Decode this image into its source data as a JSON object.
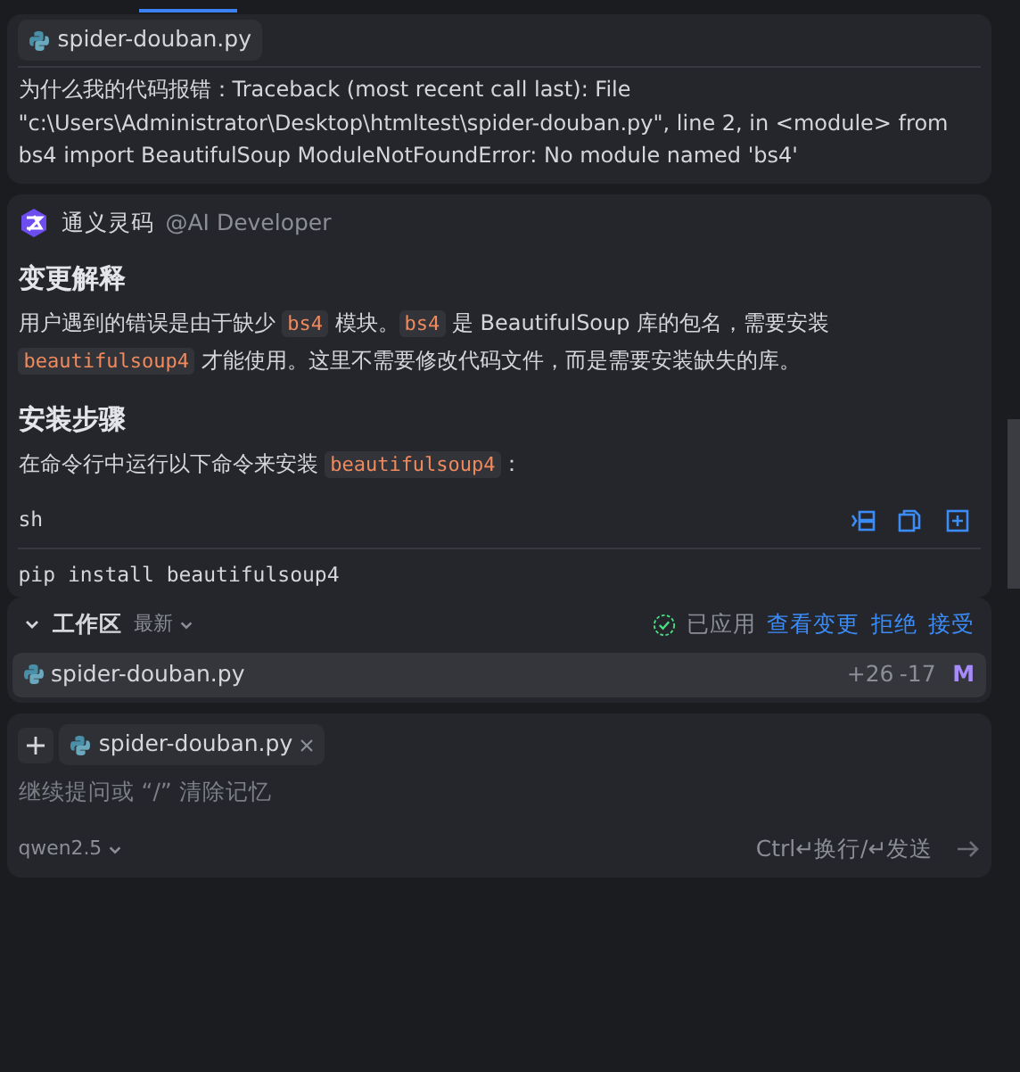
{
  "user_message": {
    "attachment": "spider-douban.py",
    "text": "为什么我的代码报错：Traceback (most recent call last): File \"c:\\Users\\Administrator\\Desktop\\htmltest\\spider-douban.py\", line 2, in <module> from bs4 import BeautifulSoup ModuleNotFoundError: No module named 'bs4'"
  },
  "assistant": {
    "name": "通义灵码",
    "handle": "@AI Developer",
    "blocks": [
      {
        "kind": "heading",
        "text": "变更解释"
      },
      {
        "kind": "paragraph",
        "segments": [
          {
            "kind": "text",
            "text": "用户遇到的错误是由于缺少 "
          },
          {
            "kind": "code",
            "text": "bs4"
          },
          {
            "kind": "text",
            "text": " 模块。"
          },
          {
            "kind": "code",
            "text": "bs4"
          },
          {
            "kind": "text",
            "text": " 是 BeautifulSoup 库的包名，需要安装 "
          },
          {
            "kind": "code",
            "text": "beautifulsoup4"
          },
          {
            "kind": "text",
            "text": " 才能使用。这里不需要修改代码文件，而是需要安装缺失的库。"
          }
        ]
      },
      {
        "kind": "heading",
        "text": "安装步骤"
      },
      {
        "kind": "paragraph",
        "segments": [
          {
            "kind": "text",
            "text": "在命令行中运行以下命令来安装 "
          },
          {
            "kind": "code",
            "text": "beautifulsoup4"
          },
          {
            "kind": "text",
            "text": "："
          }
        ]
      },
      {
        "kind": "codeblock",
        "language": "sh",
        "code": "pip install beautifulsoup4"
      }
    ]
  },
  "workspace": {
    "title": "工作区",
    "filter": "最新",
    "expanded": true,
    "status": "已应用",
    "actions": [
      "查看变更",
      "拒绝",
      "接受"
    ],
    "files": [
      {
        "name": "spider-douban.py",
        "added": "+26",
        "removed": "-17",
        "status": "M"
      }
    ]
  },
  "composer": {
    "context_file": "spider-douban.py",
    "placeholder": "继续提问或 “/” 清除记忆",
    "model": "qwen2.5",
    "hint": "Ctrl↵换行/↵发送"
  }
}
